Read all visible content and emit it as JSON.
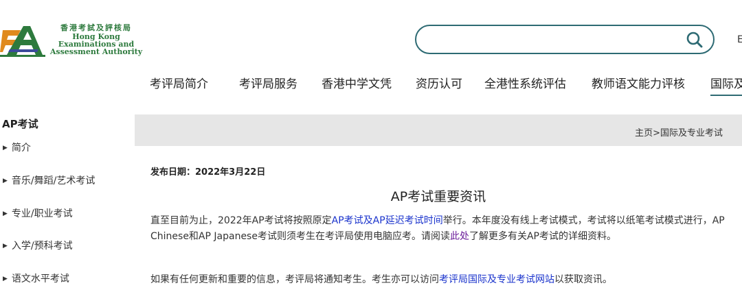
{
  "header": {
    "logo_name_zh": "香港考試及評核局",
    "logo_name_en_1": "Hong Kong",
    "logo_name_en_2": "Examinations and",
    "logo_name_en_3": "Assessment Authority",
    "search_value": "",
    "lang_partial": "E",
    "brand_color": "#2d7a3d",
    "accent_color": "#2d6a73"
  },
  "nav": {
    "items": [
      "考评局简介",
      "考评局服务",
      "香港中学文凭",
      "资历认可",
      "全港性系统评估",
      "教师语文能力评核",
      "国际及"
    ],
    "active_index": 6
  },
  "sidebar": {
    "title": "AP考试",
    "items": [
      "简介",
      "音乐/舞蹈/艺术考试",
      "专业/职业考试",
      "入学/预科考试",
      "语文水平考试"
    ]
  },
  "breadcrumb": {
    "home": "主页",
    "sep": ">",
    "current": "国际及专业考试"
  },
  "article": {
    "date_label": "发布日期：2022年3月22日",
    "title": "AP考试重要资讯",
    "p1_a": "直至目前为止，2022年AP考试将按照原定",
    "p1_link1": "AP考试及AP延迟考试时间",
    "p1_b": "举行。本年度没有线上考试模式，考试将以纸笔考试模式进行，AP Chinese和AP Japanese考试则须考生在考评局使用电脑应考。请阅读",
    "p1_link2": "此处",
    "p1_c": "了解更多有关AP考试的详细资料。",
    "p2_a": "如果有任何更新和重要的信息，考评局将通知考生。考生亦可以访问",
    "p2_link": "考评局国际及专业考试网站",
    "p2_b": "以获取资讯。"
  }
}
